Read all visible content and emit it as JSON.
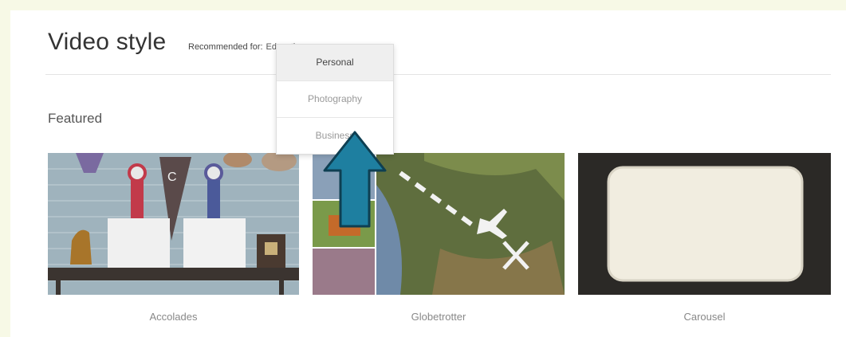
{
  "header": {
    "title": "Video style",
    "recommended_label": "Recommended for:",
    "recommended_value": "Education"
  },
  "dropdown": {
    "options": [
      "Personal",
      "Photography",
      "Business"
    ],
    "selected": "Personal"
  },
  "section": {
    "featured_label": "Featured"
  },
  "styles": [
    {
      "label": "Accolades"
    },
    {
      "label": "Globetrotter"
    },
    {
      "label": "Carousel"
    }
  ],
  "colors": {
    "arrow_fill": "#1e7fa0",
    "arrow_stroke": "#0e3f52"
  }
}
